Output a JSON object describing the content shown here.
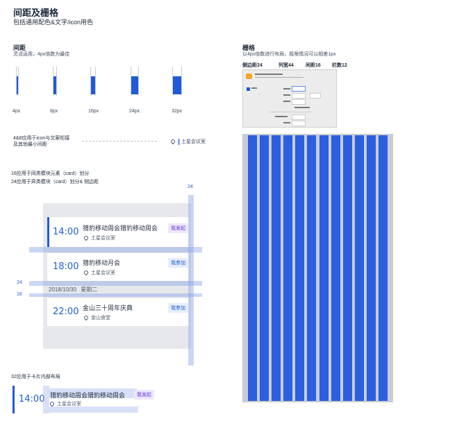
{
  "header": {
    "title": "间距及栅格",
    "subtitle": "包括通用配色&文字/icon用色"
  },
  "spacing": {
    "title": "间距",
    "desc": "灵活运用，4px倍数为最佳",
    "samples": [
      "4px",
      "8px",
      "16px",
      "24px",
      "32px"
    ],
    "note_4_8_line1": "4&8应用于icon与文案衔接",
    "note_4_8_line2": "及其他最小间距",
    "example_location": "土星会议室",
    "note_16": "16应用于同类模块元素（card）划分",
    "note_24": "24应用于异类模块（card）划分& 侧边距",
    "marker_24_top": "24",
    "marker_24_left": "24",
    "marker_16_left": "16",
    "note_32": "32应用于卡片内部布局"
  },
  "cards": [
    {
      "time": "14:00",
      "title": "猎豹移动周会猎豹移动周会",
      "location": "土星会议室",
      "tag": "我发起"
    },
    {
      "time": "18:00",
      "title": "猎豹移动月会",
      "location": "土星会议室",
      "tag": "我参加"
    },
    {
      "time": "22:00",
      "title": "金山三十周年庆典",
      "location": "金山食堂",
      "tag": "我参加"
    }
  ],
  "date_row": {
    "date": "2018/10/30",
    "weekday": "星期二"
  },
  "bottom_card": {
    "time": "14:00",
    "title": "猎豹移动周会猎豹移动周会",
    "location": "土星会议室",
    "tag": "我发起"
  },
  "grid": {
    "title": "栅格",
    "desc": "以4px倍数进行布局，极限情况可以相差1px",
    "specs": [
      "侧边距24",
      "列宽44",
      "间距16",
      "栏数12"
    ],
    "columns": 12
  },
  "colors": {
    "accent": "#1f5bd6",
    "grid_column": "#2b5fe0",
    "grid_gutter": "#c8ccd3",
    "card_bg": "#e6e8ec"
  }
}
